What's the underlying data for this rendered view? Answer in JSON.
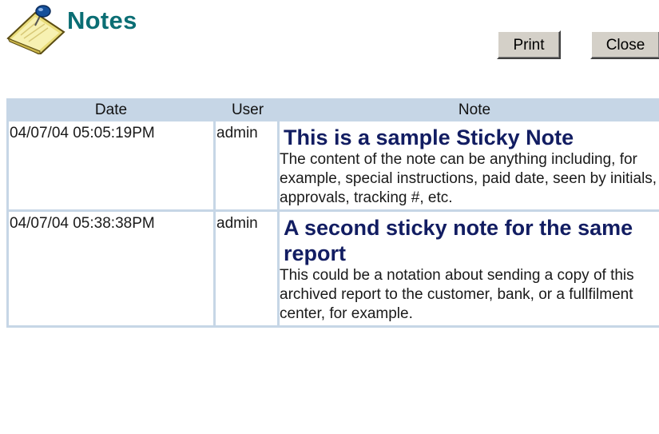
{
  "header": {
    "title": "Notes",
    "icon": "sticky-note-pushpin-icon"
  },
  "buttons": {
    "print_label": "Print",
    "close_label": "Close"
  },
  "table": {
    "columns": [
      "Date",
      "User",
      "Note"
    ],
    "rows": [
      {
        "date": "04/07/04 05:05:19PM",
        "user": "admin",
        "note_title": "This is a sample Sticky Note",
        "note_body": "The content of the note can be anything including, for example, special instructions, paid date, seen by initials, approvals, tracking #, etc."
      },
      {
        "date": "04/07/04 05:38:38PM",
        "user": "admin",
        "note_title": "A second sticky note for the same report",
        "note_body": "This could be a notation about sending a copy of this archived report to the customer, bank, or a fullfilment center, for example."
      }
    ]
  },
  "colors": {
    "title": "#0b6e74",
    "note_title": "#121d62",
    "table_header_bg": "#c6d6e6",
    "button_face": "#d4d0c8"
  }
}
